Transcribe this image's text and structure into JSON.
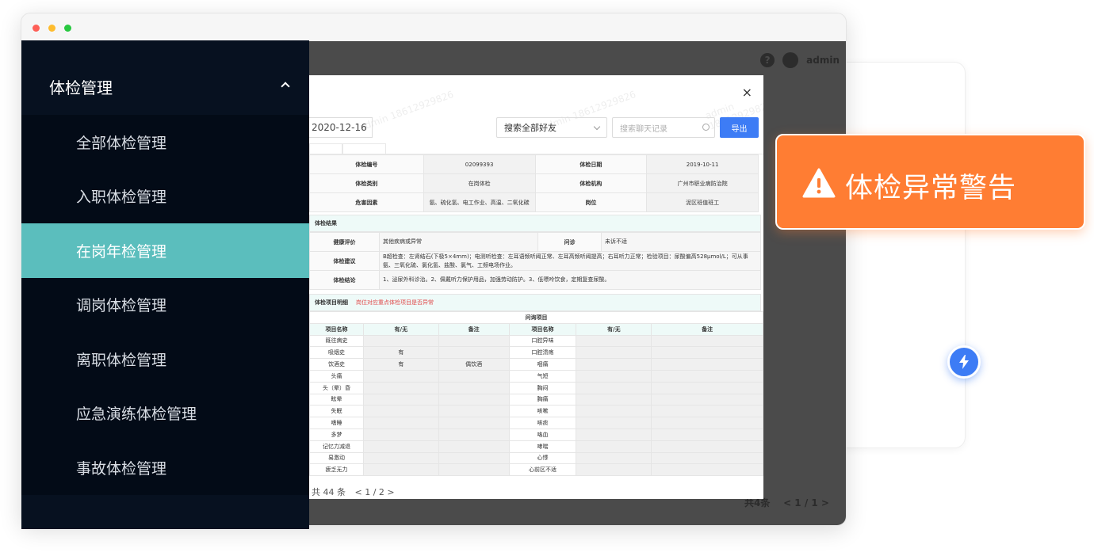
{
  "colors": {
    "sidebar_bg": "#071120",
    "active_item": "#5bbebd",
    "warning": "#ff7d33",
    "primary_button": "#3d7cf5"
  },
  "topbar": {
    "help_icon": "question-circle-icon",
    "user_name": "admin"
  },
  "sidebar": {
    "group_label": "体检管理",
    "items": [
      {
        "label": "全部体检管理",
        "active": false
      },
      {
        "label": "入职体检管理",
        "active": false
      },
      {
        "label": "在岗年检管理",
        "active": true
      },
      {
        "label": "调岗体检管理",
        "active": false
      },
      {
        "label": "离职体检管理",
        "active": false
      },
      {
        "label": "应急演练体检管理",
        "active": false
      },
      {
        "label": "事故体检管理",
        "active": false
      }
    ]
  },
  "dialog": {
    "close_glyph": "×",
    "date_value": "2020-12-16",
    "friend_select": "搜索全部好友",
    "search_placeholder": "搜索聊天记录",
    "export_label": "导出",
    "watermark": "admin\n18612929826",
    "info_rows": [
      [
        "体检编号",
        "02099393",
        "体检日期",
        "2019-10-11"
      ],
      [
        "体检类别",
        "在岗体检",
        "体检机构",
        "广州市职业病防治院"
      ],
      [
        "危害因素",
        "氨、硫化氢、电工作业、高温、二氧化碳",
        "岗位",
        "泥区班值班工"
      ]
    ],
    "result_section": "体检结果",
    "health_eval_label": "健康评价",
    "health_eval_value": "其他疾病或异常",
    "inquiry_label": "问诊",
    "inquiry_value": "未诉不适",
    "advice_label": "体检建议",
    "advice_value": "B超检查：左肾结石(下极5×4mm)；电测听检查：左耳语频听阈正常、左耳高频听阈提高；右耳听力正常；检验项目：尿酸偏高528μmol/L；可从事氨、三氧化硫、氯化氢、盐酸、氯气、工频电场作业。",
    "conclusion_label": "体检结论",
    "conclusion_value": "1、泌尿外科诊治。2、佩戴听力保护用品，加强劳动防护。3、低嘌呤饮食，定期复查尿酸。",
    "detail_section": "体检项目明细",
    "detail_note": "岗位对应重点体检项目是否异常",
    "inquiry_items_caption": "问询项目",
    "detail_headers": [
      "项目名称",
      "有/无",
      "备注",
      "项目名称",
      "有/无",
      "备注"
    ],
    "detail_rows": [
      [
        "既往病史",
        "",
        "",
        "口腔异味",
        "",
        ""
      ],
      [
        "吸烟史",
        "有",
        "",
        "口腔溃疡",
        "",
        ""
      ],
      [
        "饮酒史",
        "有",
        "偶饮酒",
        "咽痛",
        "",
        ""
      ],
      [
        "头痛",
        "",
        "",
        "气短",
        "",
        ""
      ],
      [
        "头（晕）昏",
        "",
        "",
        "胸闷",
        "",
        ""
      ],
      [
        "眩晕",
        "",
        "",
        "胸痛",
        "",
        ""
      ],
      [
        "失眠",
        "",
        "",
        "咳嗽",
        "",
        ""
      ],
      [
        "嗜睡",
        "",
        "",
        "咳痰",
        "",
        ""
      ],
      [
        "多梦",
        "",
        "",
        "咯血",
        "",
        ""
      ],
      [
        "记忆力减退",
        "",
        "",
        "哮喘",
        "",
        ""
      ],
      [
        "易激动",
        "",
        "",
        "心悸",
        "",
        ""
      ],
      [
        "疲乏无力",
        "",
        "",
        "心前区不适",
        "",
        ""
      ]
    ],
    "pager_total": "共 44 条",
    "pager_pages": "< 1 / 2 >"
  },
  "background_pager": {
    "total": "共4条",
    "pages": "< 1 / 1 >"
  },
  "warning_badge": {
    "icon": "warning-triangle-icon",
    "text": "体检异常警告"
  },
  "floating_button": {
    "icon": "lightning-bolt-icon"
  }
}
